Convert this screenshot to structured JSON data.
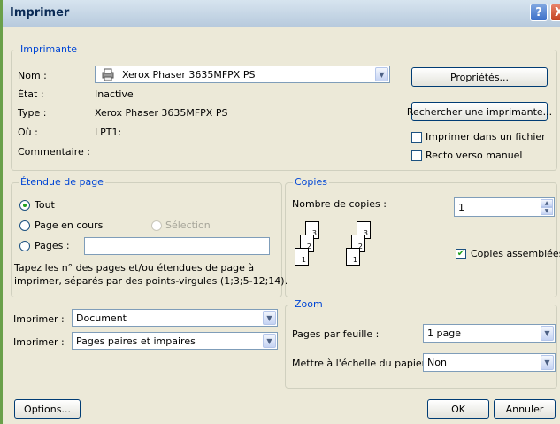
{
  "window": {
    "title": "Imprimer"
  },
  "titlebar": {
    "help": "?",
    "close": "X"
  },
  "printer": {
    "legend": "Imprimante",
    "name_label": "Nom :",
    "name_value": "Xerox Phaser 3635MFPX PS",
    "state_label": "État :",
    "state_value": "Inactive",
    "type_label": "Type :",
    "type_value": "Xerox Phaser 3635MFPX PS",
    "where_label": "Où :",
    "where_value": "LPT1:",
    "comment_label": "Commentaire :",
    "properties_button": "Propriétés...",
    "find_button": "Rechercher une imprimante...",
    "print_to_file": "Imprimer dans un fichier",
    "print_to_file_checked": false,
    "manual_duplex": "Recto verso manuel",
    "manual_duplex_checked": false
  },
  "range": {
    "legend": "Étendue de page",
    "all": "Tout",
    "current": "Page en cours",
    "selection": "Sélection",
    "pages": "Pages :",
    "pages_value": "",
    "selected": "all",
    "hint": "Tapez les n° des pages et/ou étendues de page à imprimer, séparés par des points-virgules (1;3;5-12;14).",
    "hint_line1": "Tapez les n° des pages et/ou étendues de page à",
    "hint_line2": "imprimer, séparés par des points-virgules (1;3;5-12;14)."
  },
  "copies": {
    "legend": "Copies",
    "count_label": "Nombre de copies :",
    "count_value": "1",
    "collate_label": "Copies assemblées",
    "collate_checked": true,
    "icon_pages": [
      "1",
      "2",
      "3"
    ]
  },
  "print_what": {
    "label": "Imprimer :",
    "value": "Document",
    "print_label": "Imprimer :",
    "print_value": "Pages paires et impaires"
  },
  "zoom": {
    "legend": "Zoom",
    "pages_per_sheet_label": "Pages par feuille :",
    "pages_per_sheet_value": "1 page",
    "scale_label": "Mettre à l'échelle du papier :",
    "scale_value": "Non"
  },
  "footer": {
    "options_button": "Options...",
    "ok_button": "OK",
    "cancel_button": "Annuler"
  }
}
